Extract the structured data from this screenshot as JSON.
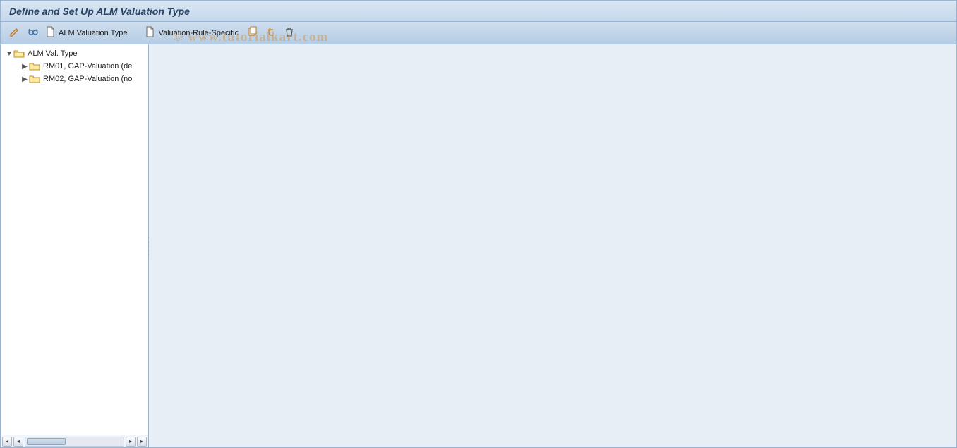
{
  "title": "Define and Set Up ALM Valuation Type",
  "toolbar": {
    "alm_valuation_type": "ALM Valuation Type",
    "valuation_rule_specific": "Valuation-Rule-Specific"
  },
  "tree": {
    "root": {
      "label": "ALM Val. Type",
      "expanded": true,
      "children": [
        {
          "label": "RM01, GAP-Valuation (de",
          "expanded": false
        },
        {
          "label": "RM02, GAP-Valuation (no",
          "expanded": false
        }
      ]
    }
  },
  "watermark": "© www.tutorialkart.com"
}
